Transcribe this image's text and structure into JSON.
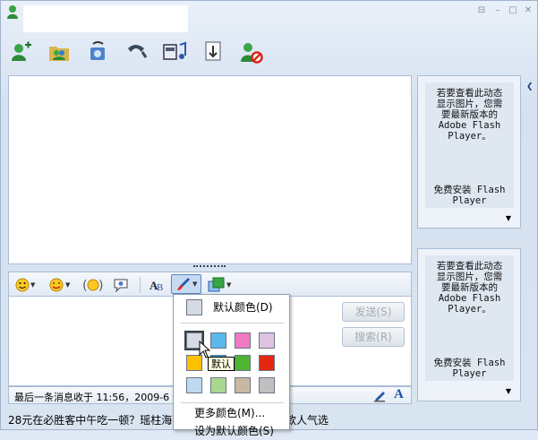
{
  "window": {
    "controls": [
      "restore-down",
      "minimize",
      "maximize",
      "close"
    ]
  },
  "toolbar": {
    "tools": [
      {
        "name": "add-contact-icon"
      },
      {
        "name": "group-icon"
      },
      {
        "name": "video-call-icon"
      },
      {
        "name": "voice-call-icon"
      },
      {
        "name": "music-icon"
      },
      {
        "name": "send-file-icon"
      },
      {
        "name": "block-contact-icon"
      }
    ]
  },
  "input_toolbar": {
    "tools": [
      {
        "name": "emoticon-icon"
      },
      {
        "name": "animated-face-icon"
      },
      {
        "name": "nudge-icon"
      },
      {
        "name": "speech-icon"
      },
      {
        "name": "font-icon"
      },
      {
        "name": "color-brush-icon"
      },
      {
        "name": "background-icon"
      }
    ]
  },
  "buttons": {
    "send": "发送(S)",
    "search": "搜索(R)"
  },
  "status_bar": {
    "text": "最后一条消息收于 11:56，2009-6"
  },
  "ticker": {
    "text_left": "28元在必胜客中午吃一顿？瑶柱海",
    "text_right": "多款人气选"
  },
  "ads": [
    {
      "lines": [
        "若要查看此动态",
        "显示图片，您需",
        "要最新版本的",
        "Adobe Flash",
        "Player。"
      ],
      "footer": [
        "免费安装 Flash",
        "Player"
      ]
    },
    {
      "lines": [
        "若要查看此动态",
        "显示图片，您需",
        "要最新版本的",
        "Adobe Flash",
        "Player。"
      ],
      "footer": [
        "免费安装 Flash",
        "Player"
      ]
    }
  ],
  "color_menu": {
    "default_color": "默认颜色(D)",
    "more_colors": "更多颜色(M)...",
    "set_default": "设为默认颜色(S)",
    "tooltip": "默认",
    "swatches": [
      "#d6dbe3",
      "#5ab8ea",
      "#f07ac2",
      "#dfc4e2",
      "#ffc000",
      "#2fa7db",
      "#4db531",
      "#e3280f",
      "#bfd9f2",
      "#a8d890",
      "#c8b8a2",
      "#c0c0c0"
    ]
  }
}
